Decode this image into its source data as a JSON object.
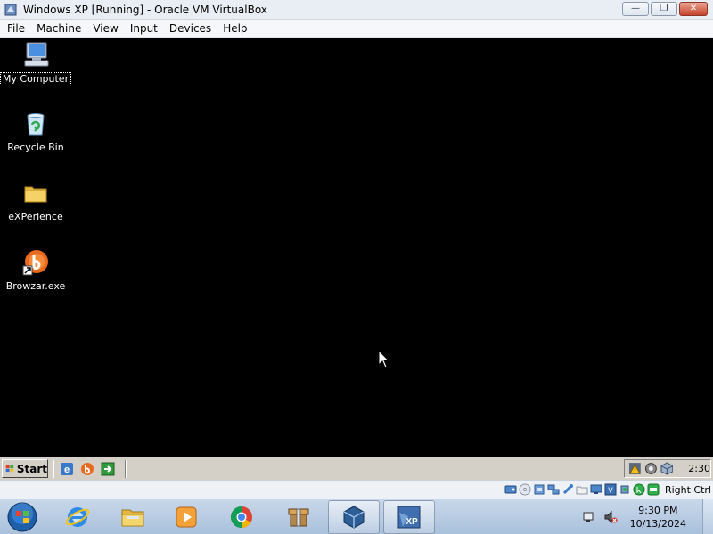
{
  "window": {
    "title": "Windows XP [Running] - Oracle VM VirtualBox",
    "buttons": [
      "minimize",
      "restore",
      "close"
    ]
  },
  "menubar": {
    "items": [
      "File",
      "Machine",
      "View",
      "Input",
      "Devices",
      "Help"
    ]
  },
  "desktop": {
    "icons": [
      {
        "label": "My Computer",
        "icon": "my-computer-icon",
        "selected": true
      },
      {
        "label": "Recycle Bin",
        "icon": "recycle-bin-icon",
        "selected": false
      },
      {
        "label": "eXPerience",
        "icon": "folder-icon",
        "selected": false
      },
      {
        "label": "Browzar.exe",
        "icon": "browzar-icon",
        "selected": false
      }
    ]
  },
  "xp_taskbar": {
    "start_label": "Start",
    "quick_launch": [
      "ie-icon",
      "browzar-icon",
      "show-desktop-icon"
    ],
    "clock": "2:30"
  },
  "vbox_status": {
    "host_key": "Right Ctrl",
    "icons": [
      "hard-disk-icon",
      "optical-drive-icon",
      "audio-icon",
      "network-icon",
      "usb-icon",
      "shared-folders-icon",
      "display-icon",
      "video-capture-icon",
      "cpu-icon",
      "mouse-integration-icon",
      "keyboard-icon"
    ]
  },
  "win7_taskbar": {
    "pinned": [
      "internet-explorer-icon",
      "file-explorer-icon",
      "media-player-icon",
      "chrome-icon",
      "archive-icon",
      "virtualbox-icon",
      "windows-xp-vm-icon"
    ],
    "time": "9:30 PM",
    "date": "10/13/2024"
  },
  "colors": {
    "guest_desktop": "#000000",
    "xp_taskbar": "#d4d0c8",
    "win7_taskbar": "#b5c9e0"
  }
}
